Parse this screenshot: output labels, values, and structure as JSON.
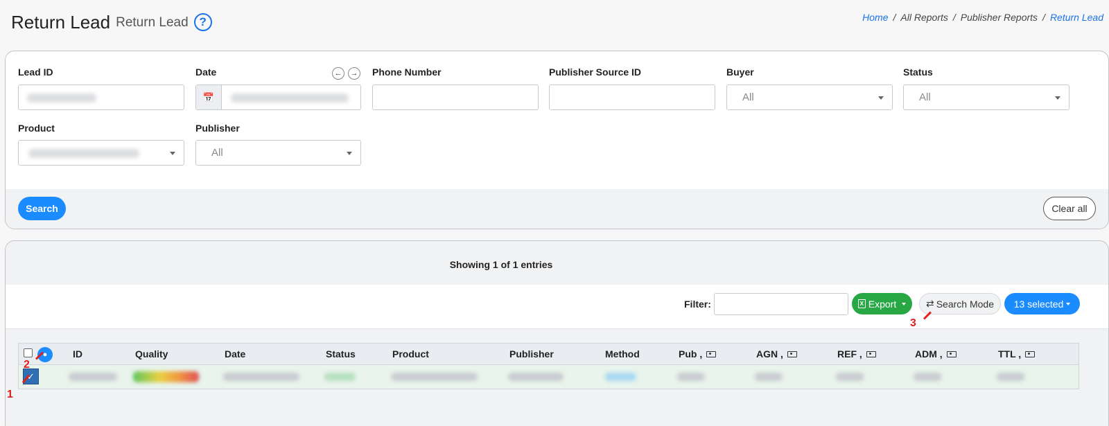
{
  "header": {
    "title": "Return Lead",
    "subtitle": "Return Lead",
    "help_glyph": "?",
    "breadcrumbs": [
      "Home",
      "All Reports",
      "Publisher Reports",
      "Return Lead"
    ],
    "breadcrumb_sep": "/"
  },
  "filters": {
    "lead_id": {
      "label": "Lead ID"
    },
    "date": {
      "label": "Date",
      "prev_glyph": "←",
      "next_glyph": "→",
      "calendar_glyph": "📅"
    },
    "phone": {
      "label": "Phone Number"
    },
    "publisher_source": {
      "label": "Publisher Source ID"
    },
    "buyer": {
      "label": "Buyer",
      "value": "All"
    },
    "status": {
      "label": "Status",
      "value": "All"
    },
    "product": {
      "label": "Product"
    },
    "publisher": {
      "label": "Publisher",
      "value": "All"
    },
    "search_label": "Search",
    "clear_label": "Clear all"
  },
  "results": {
    "showing": "Showing 1 of 1 entries",
    "filter_label": "Filter:",
    "export_label": "Export",
    "export_glyph": "X",
    "search_mode_label": "Search Mode",
    "search_mode_glyph": "⇄",
    "columns_label": "13 selected",
    "edit_glyph": "✓",
    "person_glyph": "●",
    "columns": [
      "ID",
      "Quality",
      "Date",
      "Status",
      "Product",
      "Publisher",
      "Method",
      "Pub ,",
      "AGN ,",
      "REF ,",
      "ADM ,",
      "TTL ,"
    ]
  },
  "annotations": [
    "1",
    "2",
    "3"
  ],
  "colors": {
    "accent": "#1a8cff",
    "export": "#28a745",
    "annotation": "#e02020",
    "row_bg": "#e8f4ec"
  }
}
